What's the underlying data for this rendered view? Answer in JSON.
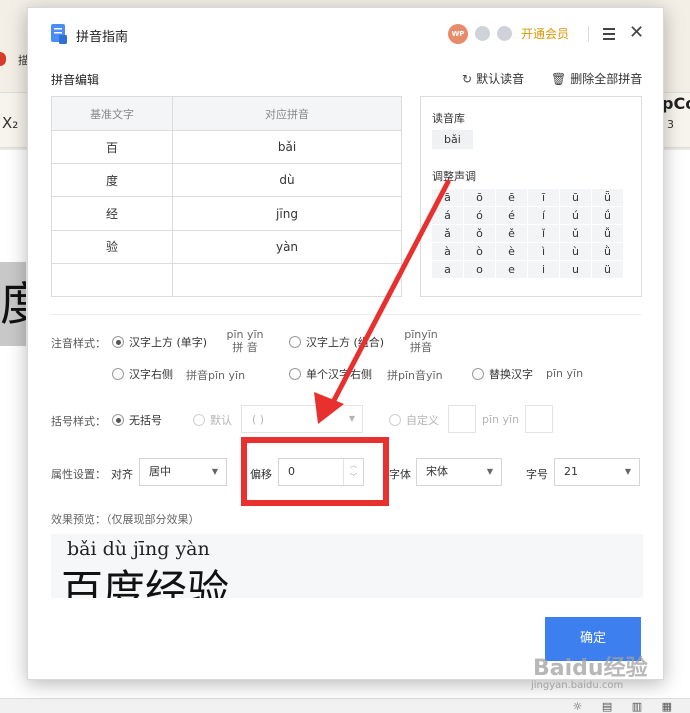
{
  "background_app": {
    "tab_letter": "描",
    "ribbon_left": "X₂",
    "ribbon_right_title": "pCo",
    "ribbon_right_sub": "3",
    "doc_char": "度"
  },
  "dialog": {
    "title": "拼音指南",
    "avatar": "WP",
    "vip_label": "开通会员",
    "section_title": "拼音编辑",
    "actions": {
      "default_reading": "默认读音",
      "delete_all": "删除全部拼音"
    },
    "table": {
      "headers": [
        "基准文字",
        "对应拼音"
      ],
      "rows": [
        {
          "char": "百",
          "pinyin": "bǎi"
        },
        {
          "char": "度",
          "pinyin": "dù"
        },
        {
          "char": "经",
          "pinyin": "jīng"
        },
        {
          "char": "验",
          "pinyin": "yàn"
        },
        {
          "char": "",
          "pinyin": ""
        }
      ]
    },
    "library": {
      "title": "读音库",
      "chip": "bǎi",
      "tone_title": "调整声调",
      "tones": [
        [
          "ā",
          "ō",
          "ē",
          "ī",
          "ū",
          "ǖ"
        ],
        [
          "á",
          "ó",
          "é",
          "í",
          "ú",
          "ǘ"
        ],
        [
          "ǎ",
          "ǒ",
          "ě",
          "ǐ",
          "ǔ",
          "ǚ"
        ],
        [
          "à",
          "ò",
          "è",
          "ì",
          "ù",
          "ǜ"
        ],
        [
          "a",
          "o",
          "e",
          "i",
          "u",
          "ü"
        ]
      ]
    },
    "annotation_style": {
      "label": "注音样式：",
      "options": [
        {
          "label": "汉字上方 (单字)",
          "hint_top": "pīn yīn",
          "hint_bottom": "拼  音"
        },
        {
          "label": "汉字上方 (组合)",
          "hint_top": "pīnyīn",
          "hint_bottom": "拼音"
        },
        {
          "label": "汉字右侧",
          "hint": "拼音pīn yīn"
        },
        {
          "label": "单个汉字右侧",
          "hint": "拼pīn音yīn"
        },
        {
          "label": "替换汉字",
          "hint": "pīn yīn"
        }
      ]
    },
    "bracket_style": {
      "label": "括号样式：",
      "none_label": "无括号",
      "default_label": "默认",
      "default_value": "( )",
      "custom_label": "自定义",
      "custom_hint": "pīn yīn"
    },
    "attributes": {
      "label": "属性设置：",
      "align_label": "对齐",
      "align_value": "居中",
      "offset_label": "偏移",
      "offset_value": "0",
      "font_label": "字体",
      "font_value": "宋体",
      "size_label": "字号",
      "size_value": "21"
    },
    "preview": {
      "label": "效果预览：（仅展现部分效果）",
      "pinyin_line": "bǎi  dù  jīng yàn",
      "hanzi_line": "百度经验"
    },
    "ok_label": "确定"
  },
  "watermark": {
    "main": "Baidu经验",
    "sub": "jingyan.baidu.com"
  }
}
